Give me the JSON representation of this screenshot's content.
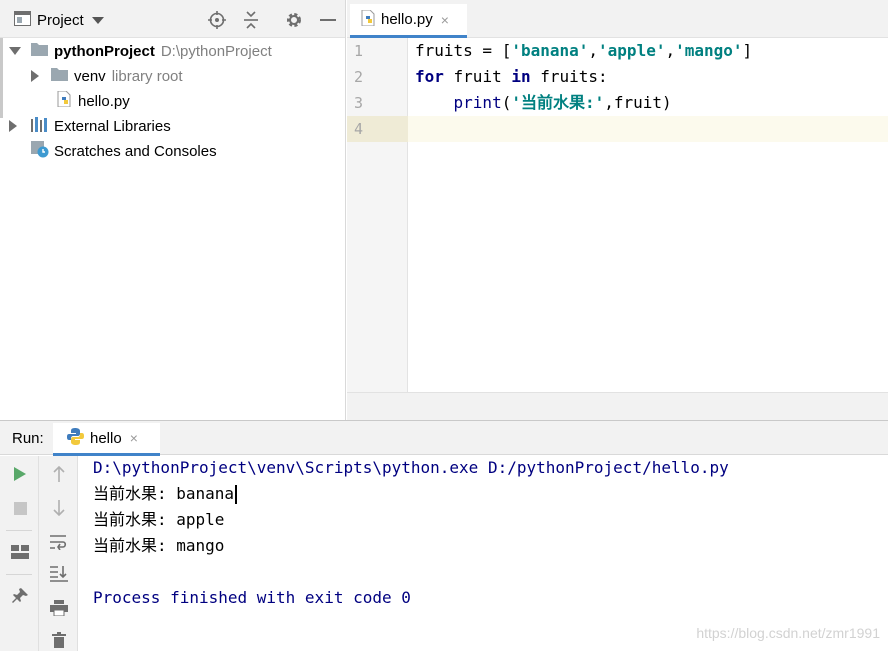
{
  "project_panel": {
    "title": "Project",
    "tree": [
      {
        "label": "pythonProject",
        "detail": "D:\\pythonProject",
        "expanded": true,
        "icon": "folder-icon"
      },
      {
        "label": "venv",
        "detail": "library root",
        "expanded": false,
        "icon": "folder-icon"
      },
      {
        "label": "hello.py",
        "icon": "python-file-icon"
      },
      {
        "label": "External Libraries",
        "expanded": false,
        "icon": "libraries-icon"
      },
      {
        "label": "Scratches and Consoles",
        "icon": "scratches-icon"
      }
    ]
  },
  "editor": {
    "tab_label": "hello.py",
    "tab_close": "×",
    "line_numbers": [
      "1",
      "2",
      "3",
      "4"
    ],
    "code": {
      "l1_var": "fruits = [",
      "l1_s1": "'banana'",
      "l1_c1": ",",
      "l1_s2": "'apple'",
      "l1_c2": ",",
      "l1_s3": "'mango'",
      "l1_end": "]",
      "l2_kw1": "for",
      "l2_mid": " fruit ",
      "l2_kw2": "in",
      "l2_end": " fruits:",
      "l3_indent": "    ",
      "l3_fn": "print",
      "l3_open": "(",
      "l3_str": "'当前水果:'",
      "l3_end": ",fruit)"
    }
  },
  "run_panel": {
    "label": "Run:",
    "tab_label": "hello",
    "tab_close": "×",
    "console": {
      "command": "D:\\pythonProject\\venv\\Scripts\\python.exe D:/pythonProject/hello.py",
      "outputs": [
        "当前水果: banana",
        "当前水果: apple",
        "当前水果: mango"
      ],
      "exit_message": "Process finished with exit code 0"
    }
  },
  "watermark": "https://blog.csdn.net/zmr1991",
  "colors": {
    "accent_tab": "#4083c9",
    "keyword": "#000080",
    "string": "#008080",
    "run_green": "#59a869"
  }
}
